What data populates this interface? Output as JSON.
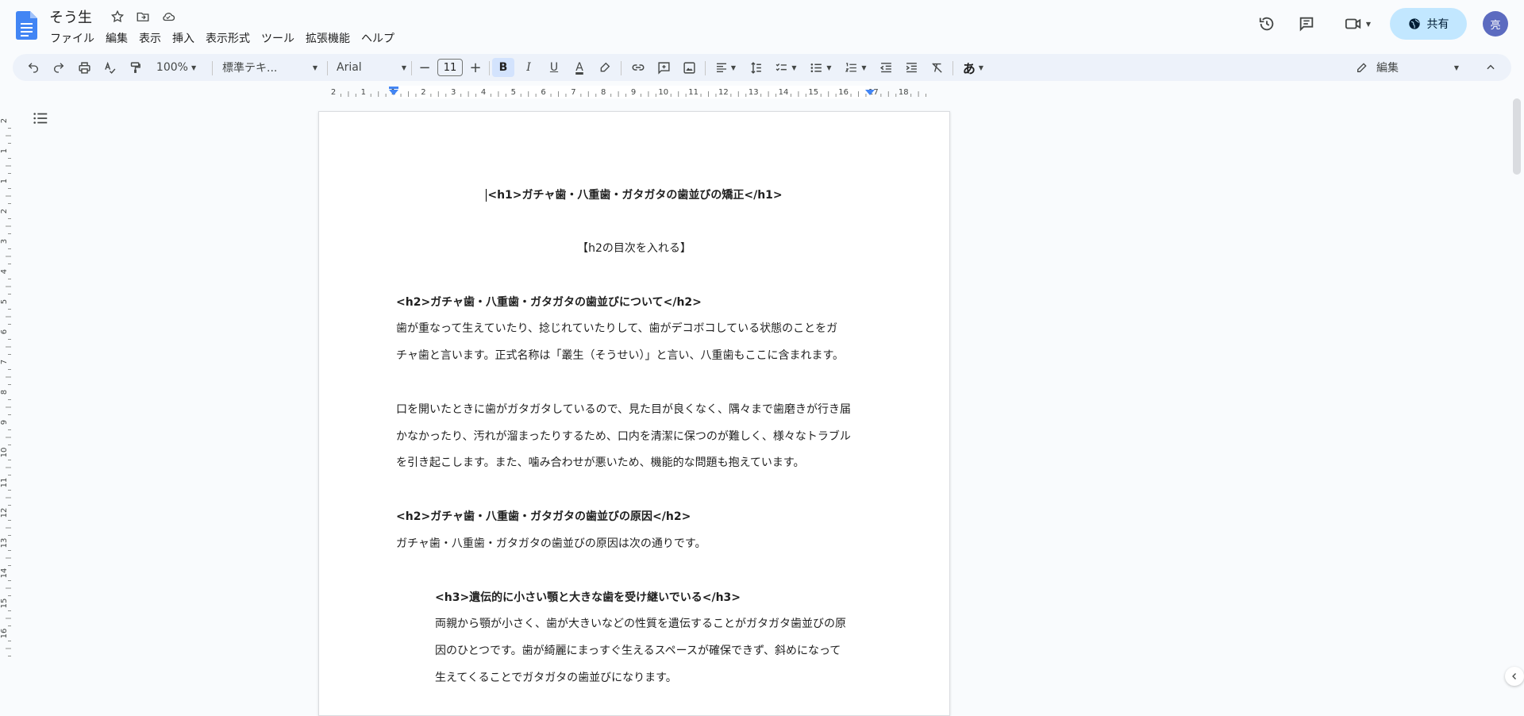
{
  "document": {
    "title": "そう生"
  },
  "menu": [
    "ファイル",
    "編集",
    "表示",
    "挿入",
    "表示形式",
    "ツール",
    "拡張機能",
    "ヘルプ"
  ],
  "topbar": {
    "share_label": "共有",
    "avatar_initial": "亮"
  },
  "toolbar": {
    "zoom": "100%",
    "style": "標準テキ...",
    "font": "Arial",
    "font_size": "11",
    "bold": "B",
    "italic": "I",
    "underline": "U",
    "text_color": "A",
    "input_tools": "あ",
    "mode": "編集"
  },
  "ruler": {
    "h_labels": [
      "2",
      "1",
      "1",
      "2",
      "3",
      "4",
      "5",
      "6",
      "7",
      "8",
      "9",
      "10",
      "11",
      "12",
      "13",
      "14",
      "15",
      "16",
      "17",
      "18"
    ],
    "v_labels": [
      "2",
      "1",
      "1",
      "2",
      "3",
      "4",
      "5",
      "6",
      "7",
      "8",
      "9",
      "10",
      "11",
      "12",
      "13",
      "14",
      "15",
      "16"
    ]
  },
  "content": {
    "h1": "<h1>ガチャ歯・八重歯・ガタガタの歯並びの矯正</h1>",
    "toc": "【h2の目次を入れる】",
    "h2_1": "<h2>ガチャ歯・八重歯・ガタガタの歯並びについて</h2>",
    "p1_l1": "歯が重なって生えていたり、捻じれていたりして、歯がデコボコしている状態のことをガ",
    "p1_l2": "チャ歯と言います。正式名称は「叢生（そうせい）」と言い、八重歯もここに含まれます。",
    "p2_l1": "口を開いたときに歯がガタガタしているので、見た目が良くなく、隅々まで歯磨きが行き届",
    "p2_l2": "かなかったり、汚れが溜まったりするため、口内を清潔に保つのが難しく、様々なトラブル",
    "p2_l3": "を引き起こします。また、噛み合わせが悪いため、機能的な問題も抱えています。",
    "h2_2": "<h2>ガチャ歯・八重歯・ガタガタの歯並びの原因</h2>",
    "p3": "ガチャ歯・八重歯・ガタガタの歯並びの原因は次の通りです。",
    "h3_1": "<h3>遺伝的に小さい顎と大きな歯を受け継いでいる</h3>",
    "p4_l1": "両親から顎が小さく、歯が大きいなどの性質を遺伝することがガタガタ歯並びの原",
    "p4_l2": "因のひとつです。歯が綺麗にまっすぐ生えるスペースが確保できず、斜めになって",
    "p4_l3": "生えてくることでガタガタの歯並びになります。"
  }
}
